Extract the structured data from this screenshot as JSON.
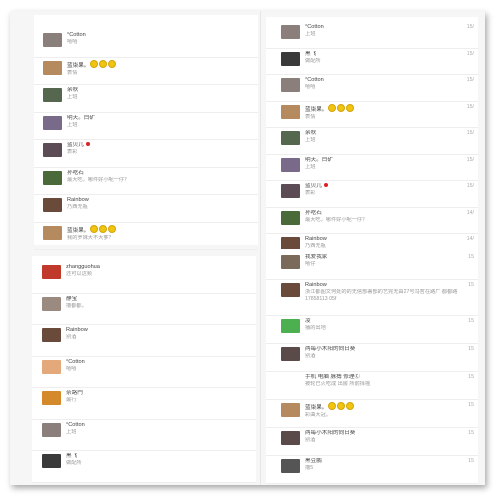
{
  "left_top": [
    {
      "name": "°Cotton",
      "msg": "嘻嘻",
      "avatar": "#8a7f7a"
    },
    {
      "name": "蓝柒果。",
      "emoji": true,
      "msg": "表情",
      "avatar": "#b58a5e"
    },
    {
      "name": "余秋",
      "msg": "上班",
      "avatar": "#55674e"
    },
    {
      "name": "明天。白矿",
      "msg": "上班",
      "avatar": "#7a6a8a"
    },
    {
      "name": "蓝贝儿",
      "dot": true,
      "msg": "表彩",
      "avatar": "#5c4c55"
    },
    {
      "name": "孙吃石",
      "msg": "最大吃，哪件好小呢一仔？",
      "avatar": "#4a6a3a"
    },
    {
      "name": "Rainbow",
      "msg": "乃西无瓶",
      "avatar": "#6a4a3a"
    },
    {
      "name": "蓝柒果。",
      "emoji": true,
      "msg": "我的罗妹大不大爹？",
      "avatar": "#b58a5e"
    }
  ],
  "left_bottom": [
    {
      "name": "zhangguohua",
      "msg": "还可以这频",
      "avatar": "#c0392b"
    },
    {
      "name": "静宝",
      "msg": "撸都都。",
      "avatar": "#9a8a80"
    },
    {
      "name": "Rainbow",
      "msg": "别酒",
      "avatar": "#6a4a3a"
    },
    {
      "name": "°Cotton",
      "msg": "嘻嘻",
      "avatar": "#e3a97a"
    },
    {
      "name": "奈路門",
      "msg": "最行",
      "avatar": "#d48a2a"
    },
    {
      "name": "°Cotton",
      "msg": "上班",
      "avatar": "#8a7f7a"
    },
    {
      "name": "黑飞",
      "msg": "做配所",
      "avatar": "#3a3a3a"
    }
  ],
  "right_top": [
    {
      "name": "°Cotton",
      "msg": "上班",
      "time": "15/",
      "avatar": "#8a7f7a"
    },
    {
      "name": "黑飞",
      "msg": "做配所",
      "time": "15/",
      "avatar": "#3a3a3a"
    },
    {
      "name": "°Cotton",
      "msg": "嘻嘻",
      "time": "15/",
      "avatar": "#8a7f7a"
    },
    {
      "name": "蓝柒果。",
      "emoji": true,
      "msg": "表情",
      "time": "15/",
      "avatar": "#b58a5e"
    },
    {
      "name": "余秋",
      "msg": "上班",
      "time": "15/",
      "avatar": "#55674e"
    },
    {
      "name": "明天。白矿",
      "msg": "上班",
      "time": "15/",
      "avatar": "#7a6a8a"
    },
    {
      "name": "蓝贝儿",
      "dot": true,
      "msg": "表彩",
      "time": "15/",
      "avatar": "#5c4c55"
    },
    {
      "name": "孙吃石",
      "msg": "最大吃，哪件好小呢一仔？",
      "time": "14/",
      "avatar": "#4a6a3a"
    },
    {
      "name": "Rainbow",
      "msg": "乃西无瓶",
      "time": "14/",
      "avatar": "#6a4a3a"
    }
  ],
  "right_bottom": [
    {
      "name": "我爱我家",
      "msg": "嘻仔",
      "time": "15",
      "avatar": "#7a6a5a"
    },
    {
      "name": "Rainbow",
      "msg": "浙江都图文何处的的无信部署部的艺完无由27号冯哲在路厂 都都路17858113 05f",
      "time": "15",
      "avatar": "#6a4a3a",
      "tall": true
    },
    {
      "name": "凌",
      "msg": "播的出地",
      "time": "15",
      "avatar": "#4caf50"
    },
    {
      "name": "两每小木阳的向日葵",
      "msg": "别酒",
      "time": "15",
      "avatar": "#5a4a4a"
    },
    {
      "name": "手机 电脑 脉搏 修理Ⓒ",
      "msg": "被轮已火吃成 出房 所前择摇",
      "time": "15",
      "avatar": "#111111",
      "apple": true
    },
    {
      "name": "蓝柒果。",
      "emoji": true,
      "msg": "彩曲大冠。",
      "time": "15",
      "avatar": "#b58a5e"
    },
    {
      "name": "两每小木阳的向日葵",
      "msg": "别酒",
      "time": "15",
      "avatar": "#5a4a4a"
    },
    {
      "name": "黑豆鹏",
      "msg": "撸5",
      "time": "15",
      "avatar": "#555555"
    }
  ]
}
